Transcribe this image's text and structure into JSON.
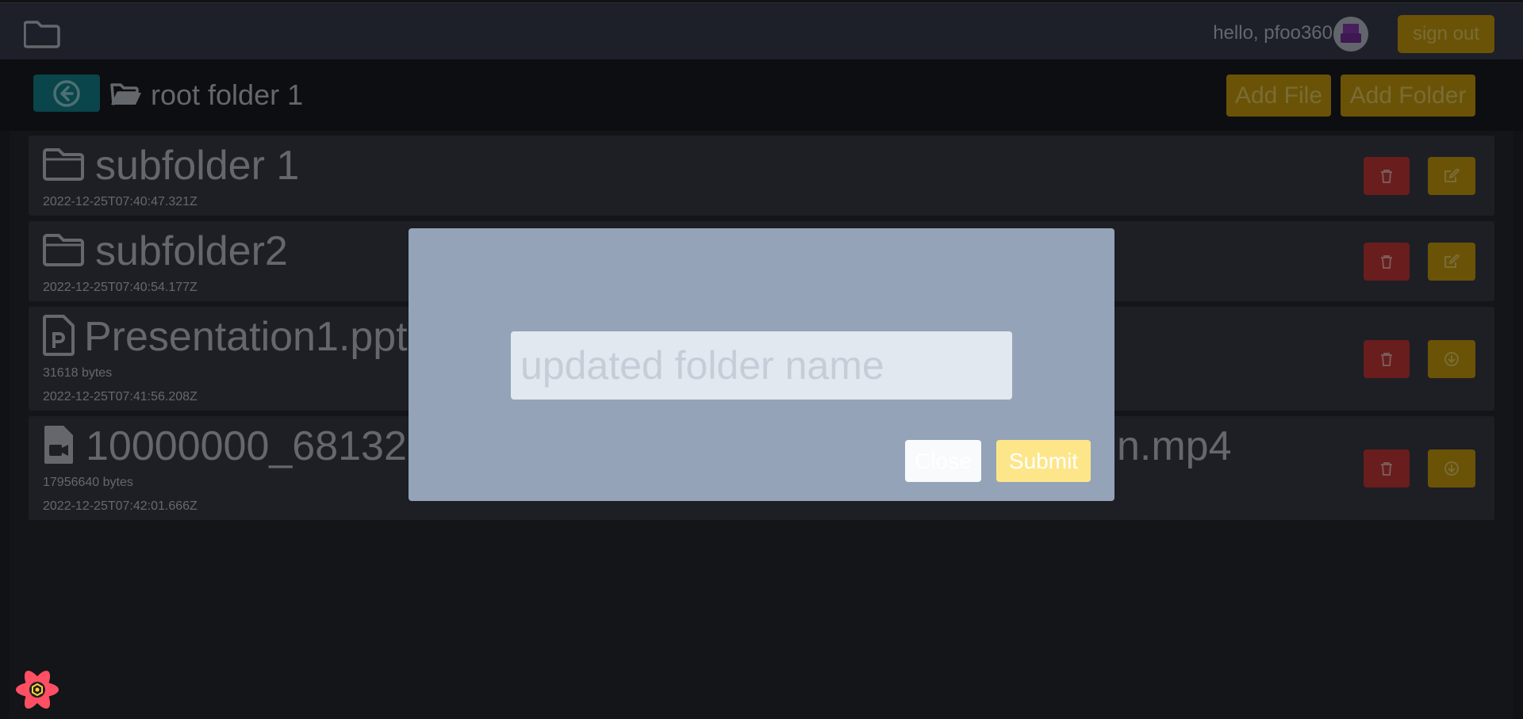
{
  "header": {
    "logo_icon": "folder-icon",
    "greeting": "hello, pfoo360",
    "avatar_icon": "avatar",
    "sign_out_label": "sign out"
  },
  "toolbar": {
    "back_icon": "circle-arrow-left-icon",
    "folder_icon": "folder-open-icon",
    "current_folder": "root folder 1",
    "add_file_label": "Add File",
    "add_folder_label": "Add Folder"
  },
  "items": [
    {
      "type": "folder",
      "icon": "folder-icon",
      "name": "subfolder 1",
      "size": "",
      "date": "2022-12-25T07:40:47.321Z",
      "actions": [
        "trash-icon",
        "edit-icon"
      ]
    },
    {
      "type": "folder",
      "icon": "folder-icon",
      "name": "subfolder2",
      "size": "",
      "date": "2022-12-25T07:40:54.177Z",
      "actions": [
        "trash-icon",
        "edit-icon"
      ]
    },
    {
      "type": "file",
      "icon": "file-powerpoint-icon",
      "name": "Presentation1.ppt",
      "size": "31618 bytes",
      "date": "2022-12-25T07:41:56.208Z",
      "actions": [
        "trash-icon",
        "download-icon"
      ]
    },
    {
      "type": "file",
      "icon": "file-video-icon",
      "name": "10000000_681325",
      "name_tail": "n.mp4",
      "size": "17956640 bytes",
      "date": "2022-12-25T07:42:01.666Z",
      "actions": [
        "trash-icon",
        "download-icon"
      ]
    }
  ],
  "modal": {
    "input_value": "",
    "input_placeholder": "updated folder name",
    "close_label": "Close",
    "submit_label": "Submit"
  },
  "devtools_icon": "react-devtools-icon",
  "colors": {
    "accent_yellow": "#d4a60e",
    "accent_teal": "#128a96",
    "danger_red": "#d23a3a",
    "modal_bg": "#94a3b8"
  }
}
